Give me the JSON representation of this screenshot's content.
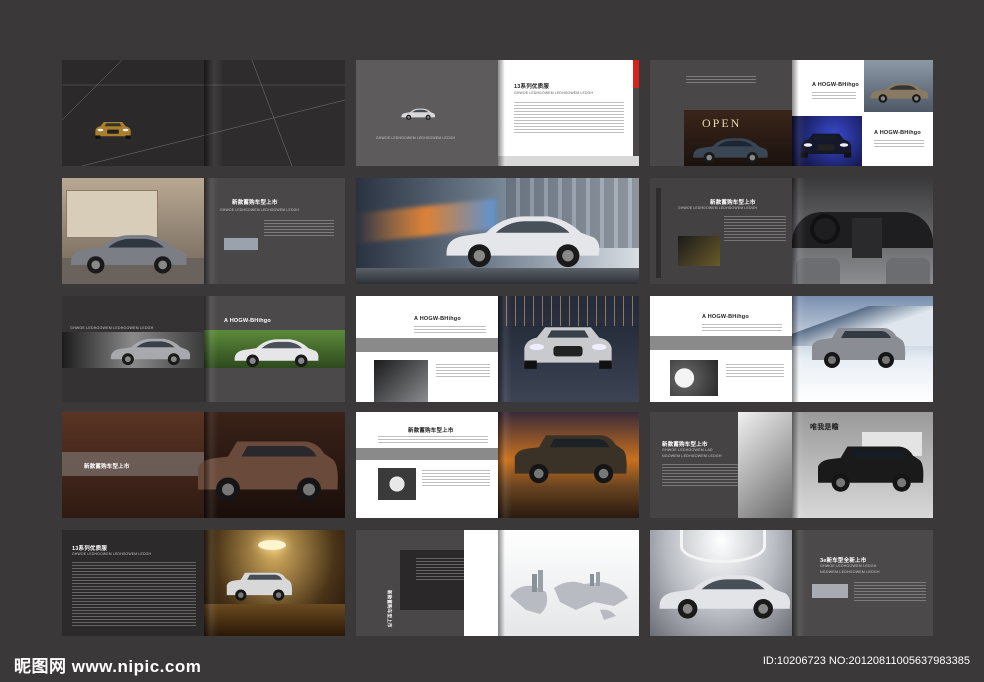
{
  "brochure": {
    "spread_1": {
      "name": "cover-spread"
    },
    "spread_2": {
      "caption": "13系列优质服",
      "subtitle": "GHWOE LEDHGOWEM LEDHGOWEM LEDGH"
    },
    "spread_3": {
      "label_1": "A HOGW-BHihgo",
      "label_2": "A HOGW-BHihgo",
      "sign": "OPEN"
    },
    "spread_4": {
      "caption": "新款蓄购车型上市",
      "subtitle": "GHWOE LEDHGOWEM LEDHGOWEM LEDGH"
    },
    "spread_6": {
      "caption": "新款蓄购车型上市",
      "subtitle": "GHWOE LEDHGOWEM LEDHGOWEM LEDGH"
    },
    "spread_7": {
      "subtitle": "GHWOE LEDHGOWEM LEDHGOWEM LEDGH",
      "label": "A HOGW-BHihgo"
    },
    "spread_8": {
      "label": "A HOGW-BHihgo"
    },
    "spread_9": {
      "label": "A HOGW-BHihgo"
    },
    "spread_10": {
      "caption": "新款蓄购车型上市"
    },
    "spread_11": {
      "caption": "新款蓄购车型上市"
    },
    "spread_12": {
      "caption": "新款蓄购车型上市",
      "subtitle_1": "GHWOE LEDHGOWEM LAD",
      "subtitle_2": "NGOWEM LEDHGOWEM LEDGH",
      "heading": "唯我是瞻"
    },
    "spread_13": {
      "caption": "13系列优质服",
      "subtitle": "GHWOE LEDHGOWEM LEDHGOWEM LEDGH"
    },
    "spread_14": {
      "caption": "新款蓄购车型上市"
    },
    "spread_15": {
      "caption": "3e新车型全新上市",
      "subtitle_1": "GHWOE LEDHGOWEM LEDGH",
      "subtitle_2": "NGOWEM LEDHGOWEM LEDGH"
    }
  },
  "watermark": {
    "logo": "昵图网 www.nipic.com",
    "id_text": "ID:10206723 NO:20120811005637983385"
  }
}
